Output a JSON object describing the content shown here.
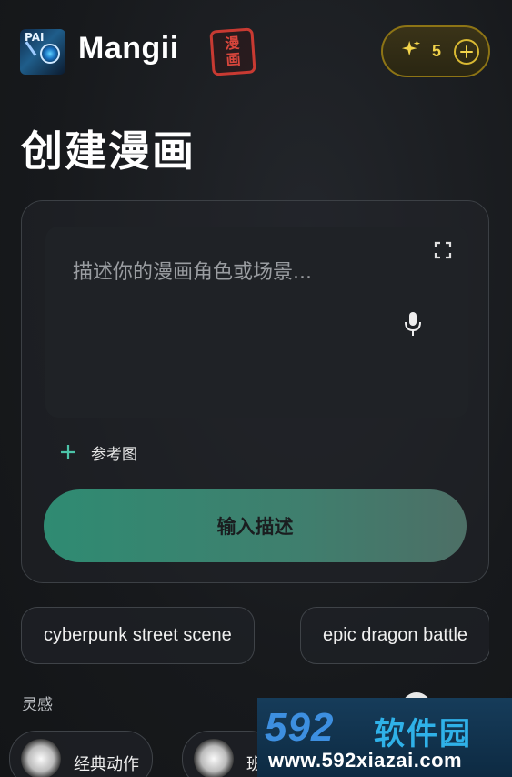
{
  "header": {
    "logo_text": "PAI",
    "brand": "Mangii",
    "seal_chars": [
      "漫",
      "画"
    ],
    "credits": {
      "count": "5",
      "spark_icon": "sparkles-icon",
      "add_icon": "plus-circle-icon"
    }
  },
  "page": {
    "title": "创建漫画"
  },
  "composer": {
    "placeholder": "描述你的漫画角色或场景...",
    "reference_label": "参考图",
    "submit_label": "输入描述"
  },
  "suggestions": [
    {
      "label": "cyberpunk street scene"
    },
    {
      "label": "epic dragon battle"
    }
  ],
  "inspiration": {
    "label": "灵感",
    "items": [
      {
        "label": "经典动作"
      },
      {
        "label": "班"
      }
    ]
  },
  "watermark": {
    "brand_number": "592",
    "brand_cn": "软件园",
    "url": "www.592xiazai.com"
  },
  "colors": {
    "accent": "#2f8b72",
    "credit_gold": "#f3d44b",
    "seal_red": "#c83a32",
    "background": "#17191c"
  }
}
